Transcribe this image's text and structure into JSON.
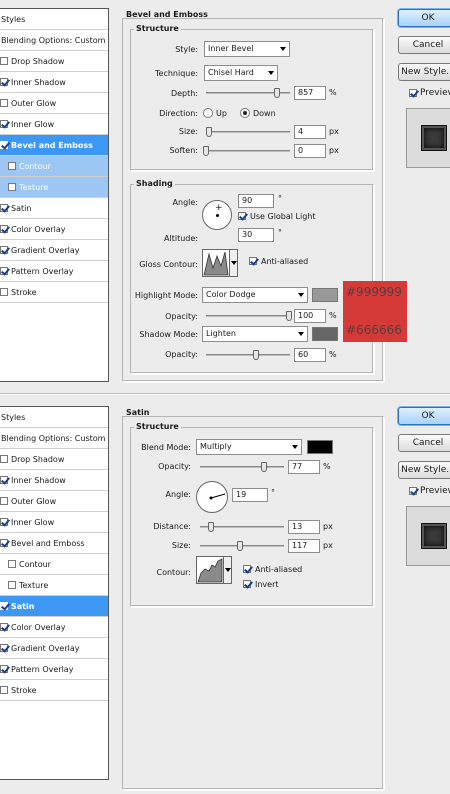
{
  "colors": {
    "accent_selected": "#3d98f4",
    "hex_box": "#d63a38",
    "swatch_gray": "#999999",
    "swatch_dark": "#666666",
    "satin_swatch": "#000000"
  },
  "panel1": {
    "styles_list": [
      {
        "label": "Styles",
        "type": "header"
      },
      {
        "label": "Blending Options: Custom",
        "type": "header"
      },
      {
        "label": "Drop Shadow",
        "checked": false
      },
      {
        "label": "Inner Shadow",
        "checked": true
      },
      {
        "label": "Outer Glow",
        "checked": false
      },
      {
        "label": "Inner Glow",
        "checked": true
      },
      {
        "label": "Bevel and Emboss",
        "checked": true,
        "selected": true
      },
      {
        "label": "Contour",
        "checked": false,
        "sub": true
      },
      {
        "label": "Texture",
        "checked": false,
        "sub": true
      },
      {
        "label": "Satin",
        "checked": true
      },
      {
        "label": "Color Overlay",
        "checked": true
      },
      {
        "label": "Gradient Overlay",
        "checked": true
      },
      {
        "label": "Pattern Overlay",
        "checked": true
      },
      {
        "label": "Stroke",
        "checked": false
      }
    ],
    "title": "Bevel and Emboss",
    "structure": {
      "title": "Structure",
      "style_label": "Style:",
      "style_value": "Inner Bevel",
      "technique_label": "Technique:",
      "technique_value": "Chisel Hard",
      "depth_label": "Depth:",
      "depth_value": "857",
      "depth_unit": "%",
      "direction_label": "Direction:",
      "up_label": "Up",
      "down_label": "Down",
      "size_label": "Size:",
      "size_value": "4",
      "size_unit": "px",
      "soften_label": "Soften:",
      "soften_value": "0",
      "soften_unit": "px"
    },
    "shading": {
      "title": "Shading",
      "angle_label": "Angle:",
      "angle_value": "90",
      "angle_unit": "°",
      "global_light_label": "Use Global Light",
      "altitude_label": "Altitude:",
      "altitude_value": "30",
      "altitude_unit": "°",
      "gloss_label": "Gloss Contour:",
      "anti_aliased_label": "Anti-aliased",
      "highlight_mode_label": "Highlight Mode:",
      "highlight_mode_value": "Color Dodge",
      "highlight_opacity_label": "Opacity:",
      "highlight_opacity_value": "100",
      "highlight_opacity_unit": "%",
      "shadow_mode_label": "Shadow Mode:",
      "shadow_mode_value": "Lighten",
      "shadow_opacity_label": "Opacity:",
      "shadow_opacity_value": "60",
      "shadow_opacity_unit": "%"
    },
    "hex_highlight": "#999999",
    "hex_shadow": "#666666",
    "buttons": {
      "ok": "OK",
      "cancel": "Cancel",
      "new_style": "New Style...",
      "preview": "Preview"
    }
  },
  "panel2": {
    "styles_list": [
      {
        "label": "Styles",
        "type": "header"
      },
      {
        "label": "Blending Options: Custom",
        "type": "header"
      },
      {
        "label": "Drop Shadow",
        "checked": false
      },
      {
        "label": "Inner Shadow",
        "checked": true
      },
      {
        "label": "Outer Glow",
        "checked": false
      },
      {
        "label": "Inner Glow",
        "checked": true
      },
      {
        "label": "Bevel and Emboss",
        "checked": true
      },
      {
        "label": "Contour",
        "checked": false,
        "sub": true
      },
      {
        "label": "Texture",
        "checked": false,
        "sub": true
      },
      {
        "label": "Satin",
        "checked": true,
        "selected": true
      },
      {
        "label": "Color Overlay",
        "checked": true
      },
      {
        "label": "Gradient Overlay",
        "checked": true
      },
      {
        "label": "Pattern Overlay",
        "checked": true
      },
      {
        "label": "Stroke",
        "checked": false
      }
    ],
    "title": "Satin",
    "structure": {
      "title": "Structure",
      "blend_label": "Blend Mode:",
      "blend_value": "Multiply",
      "opacity_label": "Opacity:",
      "opacity_value": "77",
      "opacity_unit": "%",
      "angle_label": "Angle:",
      "angle_value": "19",
      "angle_unit": "°",
      "distance_label": "Distance:",
      "distance_value": "13",
      "distance_unit": "px",
      "size_label": "Size:",
      "size_value": "117",
      "size_unit": "px",
      "contour_label": "Contour:",
      "anti_aliased_label": "Anti-aliased",
      "invert_label": "Invert"
    },
    "buttons": {
      "ok": "OK",
      "cancel": "Cancel",
      "new_style": "New Style...",
      "preview": "Preview"
    }
  }
}
